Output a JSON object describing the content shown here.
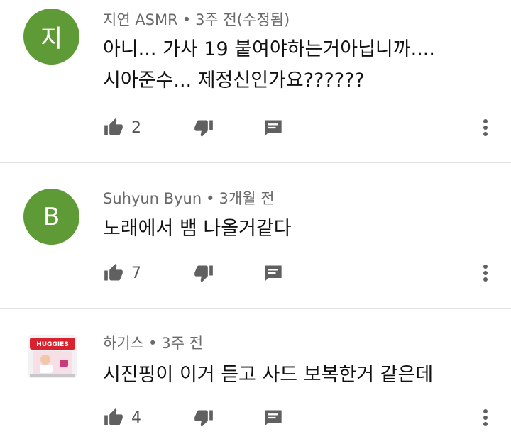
{
  "colors": {
    "avatar_green": "#5e9a35",
    "icon_gray": "#606060",
    "meta_gray": "#6a6a6a"
  },
  "comments": [
    {
      "avatar_letter": "지",
      "author": "지연 ASMR",
      "separator": "•",
      "time": "3주 전(수정됨)",
      "lines": [
        "아니... 가사 19 붙여야하는거아닙니까....",
        "시아준수... 제정신인가요??????"
      ],
      "likes": "2",
      "icons": [
        "thumbs-up-icon",
        "thumbs-down-icon",
        "reply-icon",
        "more-vert-icon"
      ]
    },
    {
      "avatar_letter": "B",
      "author": "Suhyun Byun",
      "separator": "•",
      "time": "3개월 전",
      "lines": [
        "노래에서 뱀 나올거같다"
      ],
      "likes": "7",
      "icons": [
        "thumbs-up-icon",
        "thumbs-down-icon",
        "reply-icon",
        "more-vert-icon"
      ]
    },
    {
      "avatar_letter": "",
      "author": "하기스",
      "separator": "•",
      "time": "3주 전",
      "lines": [
        "시진핑이 이거 듣고 사드 보복한거 같은데"
      ],
      "likes": "4",
      "avatar_logo_text": "HUGGIES",
      "icons": [
        "thumbs-up-icon",
        "thumbs-down-icon",
        "reply-icon",
        "more-vert-icon"
      ]
    }
  ]
}
